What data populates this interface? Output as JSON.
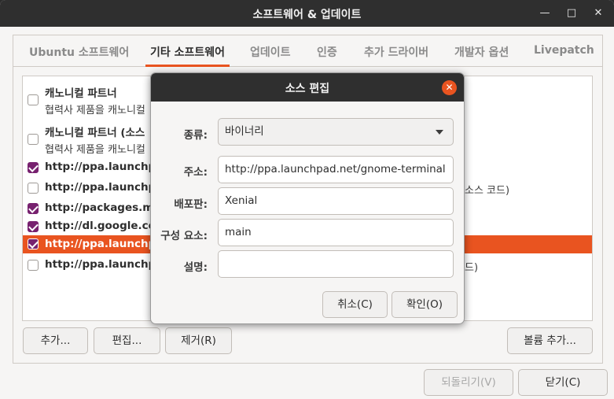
{
  "window": {
    "title": "소프트웨어 & 업데이트",
    "minimize_icon": "—",
    "maximize_icon": "□",
    "close_icon": "✕"
  },
  "tabs": [
    {
      "label": "Ubuntu 소프트웨어"
    },
    {
      "label": "기타 소프트웨어"
    },
    {
      "label": "업데이트"
    },
    {
      "label": "인증"
    },
    {
      "label": "추가 드라이버"
    },
    {
      "label": "개발자 옵션"
    },
    {
      "label": "Livepatch"
    }
  ],
  "sources": [
    {
      "line1": "캐노니컬 파트너",
      "line2": "협력사 제품을 캐노니컬",
      "checked": false
    },
    {
      "line1": "캐노니컬 파트너 (소스",
      "line2": "협력사 제품을 캐노니컬",
      "checked": false
    },
    {
      "line1": "http://ppa.launchp",
      "checked": true
    },
    {
      "line1": "http://ppa.launchp",
      "right": "소스 코드)",
      "checked": false
    },
    {
      "line1": "http://packages.mi",
      "checked": true
    },
    {
      "line1": "http://dl.google.co",
      "checked": true
    },
    {
      "line1": "http://ppa.launchp",
      "checked": true,
      "selected": true
    },
    {
      "line1": "http://ppa.launchp",
      "right": "드)",
      "checked": false
    }
  ],
  "buttons": {
    "add": "추가...",
    "edit": "편집...",
    "remove": "제거(R)",
    "add_volume": "볼륨 추가...",
    "revert": "되돌리기(V)",
    "close": "닫기(C)"
  },
  "dialog": {
    "title": "소스 편집",
    "close_icon": "✕",
    "type_label": "종류:",
    "type_value": "바이너리",
    "uri_label": "주소:",
    "uri_value": "http://ppa.launchpad.net/gnome-terminal",
    "dist_label": "배포판:",
    "dist_value": "Xenial",
    "components_label": "구성 요소:",
    "components_value": "main",
    "comment_label": "설명:",
    "comment_value": "",
    "cancel": "취소(C)",
    "ok": "확인(O)"
  },
  "colors": {
    "accent": "#e95420",
    "checkbox": "#77216f",
    "titlebar": "#2f2f2f"
  }
}
